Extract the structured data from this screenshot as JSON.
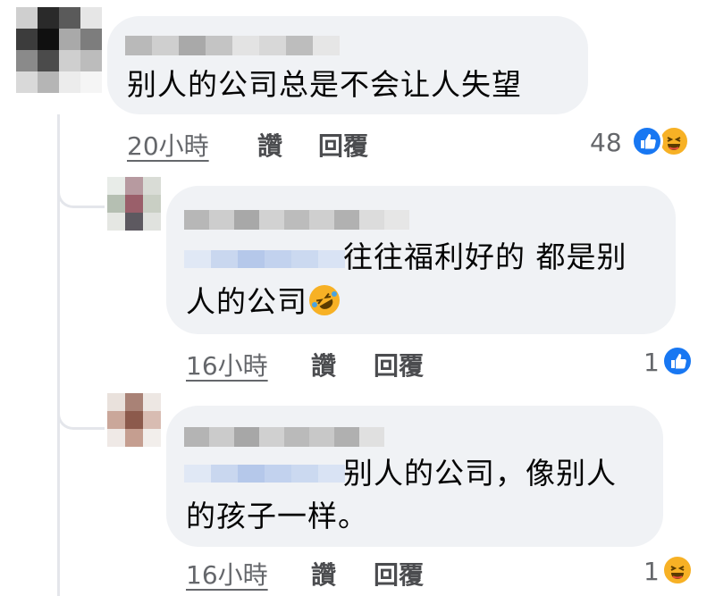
{
  "comments": [
    {
      "text_line1": "别人的公司总是不会让人失望",
      "time": "20小時",
      "like_label": "讚",
      "reply_label": "回覆",
      "reaction_count": "48",
      "reactions": [
        "like-icon",
        "haha-icon"
      ]
    },
    {
      "text_line1": "往往福利好的 都是别",
      "text_line2": "人的公司",
      "emoji": "rolling-on-floor-laughing-icon",
      "time": "16小時",
      "like_label": "讚",
      "reply_label": "回覆",
      "reaction_count": "1",
      "reactions": [
        "like-icon"
      ]
    },
    {
      "text_line1": "别人的公司，像别人",
      "text_line2": "的孩子一样。",
      "time": "16小時",
      "like_label": "讚",
      "reply_label": "回覆",
      "reaction_count": "1",
      "reactions": [
        "haha-icon"
      ]
    }
  ],
  "colors": {
    "bubble": "#f0f2f5",
    "meta_text": "#65676b",
    "like_blue": "#1877f2",
    "haha_yellow": "#f7b125"
  }
}
